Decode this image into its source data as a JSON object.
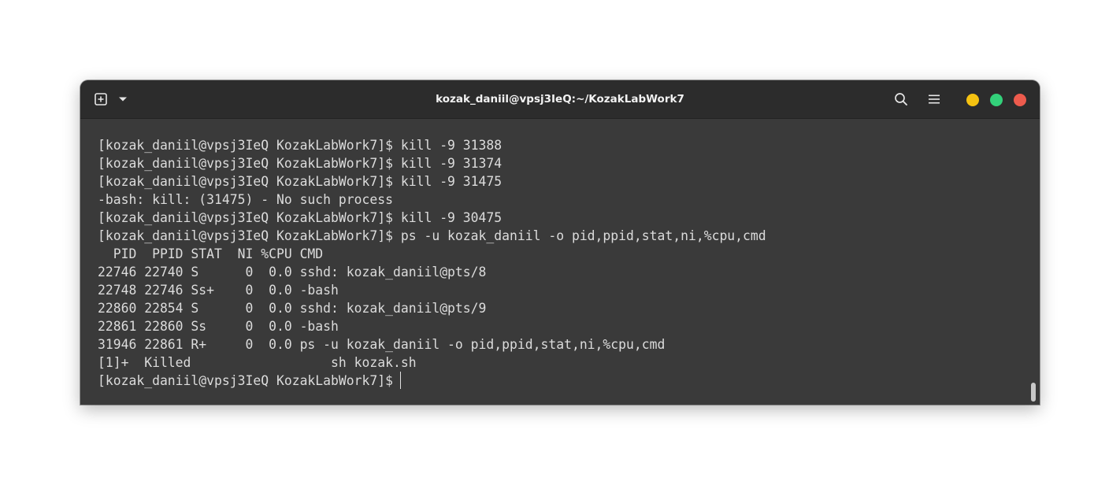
{
  "window": {
    "title": "kozak_daniil@vpsj3IeQ:~/KozakLabWork7"
  },
  "titlebar": {
    "new_tab_icon": "plus-square-icon",
    "menu_dropdown_icon": "chevron-down-icon",
    "search_icon": "search-icon",
    "hamburger_icon": "hamburger-menu-icon",
    "controls": {
      "minimize_color": "#f5c211",
      "maximize_color": "#33d17a",
      "close_color": "#ed5b4d"
    }
  },
  "terminal": {
    "lines": [
      "[kozak_daniil@vpsj3IeQ KozakLabWork7]$ kill -9 31388",
      "[kozak_daniil@vpsj3IeQ KozakLabWork7]$ kill -9 31374",
      "[kozak_daniil@vpsj3IeQ KozakLabWork7]$ kill -9 31475",
      "-bash: kill: (31475) - No such process",
      "[kozak_daniil@vpsj3IeQ KozakLabWork7]$ kill -9 30475",
      "[kozak_daniil@vpsj3IeQ KozakLabWork7]$ ps -u kozak_daniil -o pid,ppid,stat,ni,%cpu,cmd",
      "  PID  PPID STAT  NI %CPU CMD",
      "22746 22740 S      0  0.0 sshd: kozak_daniil@pts/8",
      "22748 22746 Ss+    0  0.0 -bash",
      "22860 22854 S      0  0.0 sshd: kozak_daniil@pts/9",
      "22861 22860 Ss     0  0.0 -bash",
      "31946 22861 R+     0  0.0 ps -u kozak_daniil -o pid,ppid,stat,ni,%cpu,cmd",
      "[1]+  Killed                  sh kozak.sh"
    ],
    "prompt": "[kozak_daniil@vpsj3IeQ KozakLabWork7]$"
  }
}
